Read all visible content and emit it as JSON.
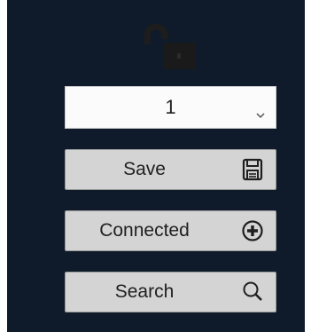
{
  "panel": {
    "background_color": "#0f1b2a",
    "lock_icon": "unlocked-padlock-icon",
    "lock_color": "#1a1a1a"
  },
  "select": {
    "value": "1",
    "icon": "chevron-down-icon"
  },
  "buttons": {
    "save": {
      "label": "Save",
      "icon": "floppy-disk-icon"
    },
    "connect": {
      "label": "Connected",
      "icon": "plus-circle-icon"
    },
    "search": {
      "label": "Search",
      "icon": "magnifier-icon"
    }
  }
}
